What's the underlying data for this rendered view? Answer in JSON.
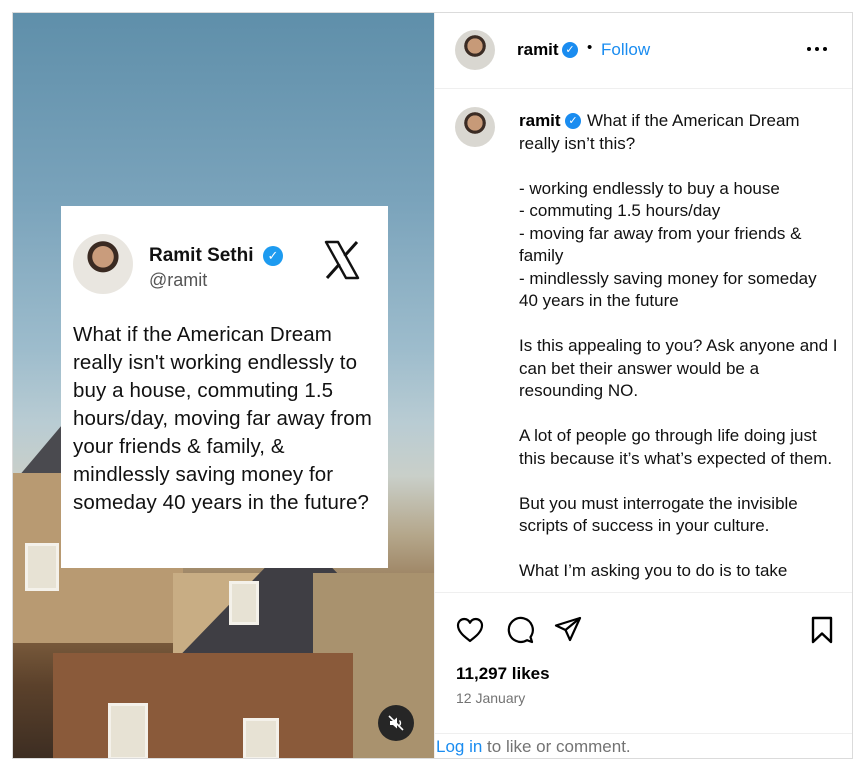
{
  "tweet": {
    "name": "Ramit Sethi",
    "handle": "@ramit",
    "text": "What if the American Dream really isn't working endlessly to buy a house, commuting 1.5 hours/day, moving far away from your friends & family, & mindlessly saving money for someday 40 years in the future?"
  },
  "header": {
    "username": "ramit",
    "separator": "•",
    "follow_label": "Follow"
  },
  "caption": {
    "username": "ramit",
    "text": "What if the American Dream really isn’t this?\n\n- working endlessly to buy a house\n- commuting 1.5 hours/day\n- moving far away from your friends & family\n- mindlessly saving money for someday 40 years in the future\n\nIs this appealing to you? Ask anyone and I can bet their answer would be a resounding NO.\n\nA lot of people go through life doing just this because it’s what’s expected of them.\n\nBut you must interrogate the invisible scripts of success in your culture.\n\nWhat I’m asking you to do is to take"
  },
  "stats": {
    "likes": "11,297 likes",
    "date": "12 January"
  },
  "login": {
    "link": "Log in",
    "rest": " to like or comment."
  },
  "icons": {
    "verified": "verified-badge-icon",
    "x_logo": "x-logo-icon",
    "mute": "muted-speaker-icon",
    "more": "more-options-icon",
    "like": "heart-icon",
    "comment": "comment-bubble-icon",
    "share": "paper-plane-icon",
    "save": "bookmark-icon"
  },
  "colors": {
    "link_blue": "#1a8cf0",
    "verified_blue": "#1d9bf0",
    "secondary_text": "#737373"
  }
}
